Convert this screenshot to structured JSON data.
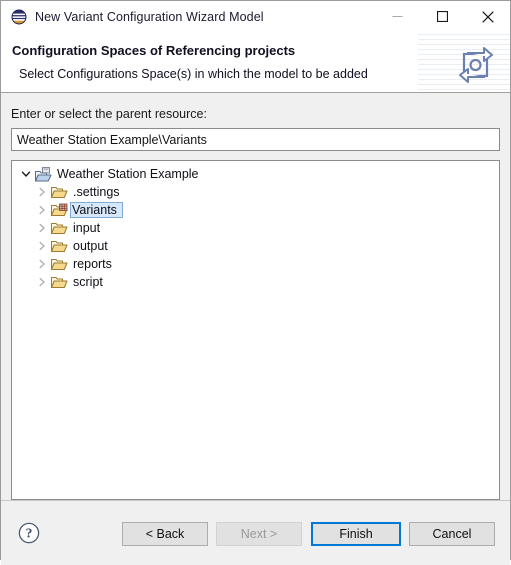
{
  "window": {
    "title": "New Variant Configuration Wizard Model",
    "app_icon": "eclipse-logo-icon",
    "controls": {
      "minimize": "minimize-icon",
      "maximize": "maximize-icon",
      "close": "close-icon"
    }
  },
  "header": {
    "title": "Configuration Spaces of Referencing projects",
    "subtitle": "Select Configurations Space(s) in which the model to be added",
    "banner_icon": "refresh-sync-icon"
  },
  "form": {
    "label": "Enter or select the parent resource:",
    "path_value": "Weather Station Example\\Variants",
    "path_placeholder": ""
  },
  "tree": {
    "root": {
      "label": "Weather Station Example",
      "icon": "project-folder-icon",
      "expanded": true,
      "twisty": "chevron-down-icon"
    },
    "children": [
      {
        "label": ".settings",
        "icon": "folder-icon",
        "twisty": "chevron-right-icon",
        "selected": false
      },
      {
        "label": "Variants",
        "icon": "variants-folder-icon",
        "twisty": "chevron-right-icon",
        "selected": true
      },
      {
        "label": "input",
        "icon": "folder-icon",
        "twisty": "chevron-right-icon",
        "selected": false
      },
      {
        "label": "output",
        "icon": "folder-icon",
        "twisty": "chevron-right-icon",
        "selected": false
      },
      {
        "label": "reports",
        "icon": "folder-icon",
        "twisty": "chevron-right-icon",
        "selected": false
      },
      {
        "label": "script",
        "icon": "folder-icon",
        "twisty": "chevron-right-icon",
        "selected": false
      }
    ]
  },
  "footer": {
    "help_icon": "help-question-icon",
    "back_label": "< Back",
    "next_label": "Next >",
    "finish_label": "Finish",
    "cancel_label": "Cancel",
    "next_disabled": true,
    "finish_default": true
  },
  "colors": {
    "accent": "#0078d7",
    "selection_bg": "#d6e8f9",
    "selection_border": "#7eaddb",
    "dialog_bg": "#f0f0f0",
    "panel_bg": "#ffffff",
    "folder": "#f0c060"
  }
}
